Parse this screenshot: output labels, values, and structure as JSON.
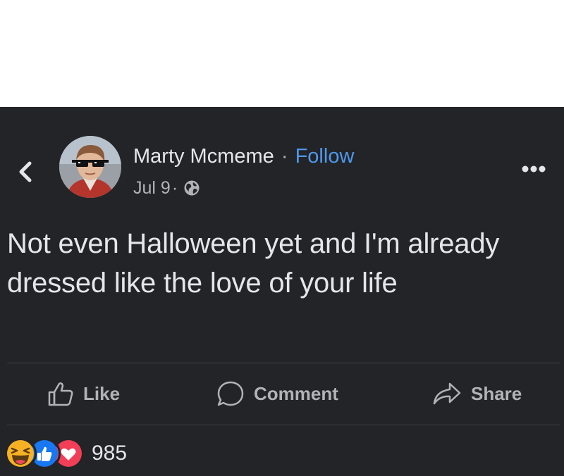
{
  "post": {
    "author": "Marty Mcmeme",
    "separator": "·",
    "follow_label": "Follow",
    "date": "Jul 9",
    "date_separator": "·",
    "text": "Not even Halloween yet and I'm already dressed like the love of your life",
    "visibility_icon": "globe-icon"
  },
  "actions": {
    "like_label": "Like",
    "comment_label": "Comment",
    "share_label": "Share"
  },
  "reactions": {
    "count": "985",
    "types": [
      "haha",
      "like",
      "love"
    ]
  },
  "colors": {
    "background": "#232427",
    "text": "#e4e6eb",
    "muted": "#b0b3b8",
    "follow": "#4e98ec",
    "like_blue": "#1877f2",
    "love_red": "#f33e58",
    "haha_yellow": "#f7b125"
  }
}
